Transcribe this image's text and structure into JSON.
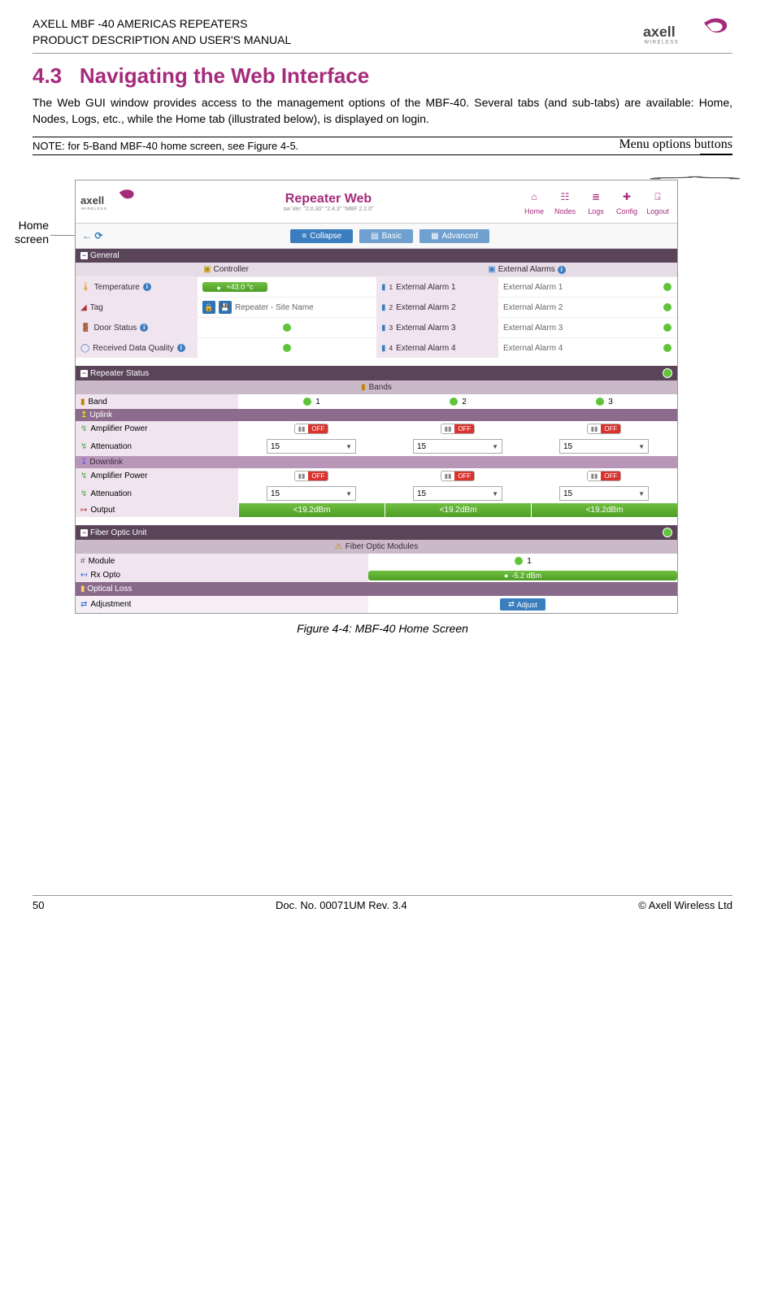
{
  "header": {
    "line1": "AXELL MBF -40 AMERICAS REPEATERS",
    "line2": "PRODUCT DESCRIPTION AND USER'S MANUAL",
    "logo_text": "axell",
    "logo_sub": "WIRELESS"
  },
  "section": {
    "number": "4.3",
    "title": "Navigating the Web Interface"
  },
  "para": "The Web GUI window provides access to the management options of the MBF-40. Several tabs (and sub-tabs) are available: Home, Nodes, Logs, etc., while the Home tab (illustrated below), is displayed on login.",
  "note": "NOTE: for 5-Band MBF-40 home screen, see Figure  4-5.",
  "annot": {
    "menu": "Menu options buttons",
    "home1": "Home",
    "home2": "screen"
  },
  "ss": {
    "logo": "axell",
    "logo_sub": "WIRELESS",
    "title": "Repeater Web",
    "swver": "sw Ver: \"2.0.30\" \"2.4.3\" \"MBF 2.2.0\"",
    "nav": [
      "Home",
      "Nodes",
      "Logs",
      "Config",
      "Logout"
    ],
    "btns": {
      "collapse": "Collapse",
      "basic": "Basic",
      "advanced": "Advanced"
    },
    "general": {
      "hdr": "General",
      "controller": "Controller",
      "ext_alarms": "External Alarms",
      "rows_left": [
        {
          "label": "Temperature",
          "info": true,
          "value_pill": "+43.0 °c"
        },
        {
          "label": "Tag",
          "value_text": "Repeater - Site Name",
          "boxes": true
        },
        {
          "label": "Door Status",
          "info": true,
          "dot": true
        },
        {
          "label": "Received Data Quality",
          "info": true,
          "dot": true
        }
      ],
      "rows_right": [
        {
          "num": "1",
          "label": "External Alarm 1",
          "value": "External Alarm 1"
        },
        {
          "num": "2",
          "label": "External Alarm 2",
          "value": "External Alarm 2"
        },
        {
          "num": "3",
          "label": "External Alarm 3",
          "value": "External Alarm 3"
        },
        {
          "num": "4",
          "label": "External Alarm 4",
          "value": "External Alarm 4"
        }
      ]
    },
    "repeater": {
      "hdr": "Repeater Status",
      "bands_hdr": "Bands",
      "band_lbl": "Band",
      "bands": [
        "1",
        "2",
        "3"
      ],
      "uplink": "Uplink",
      "downlink": "Downlink",
      "amp": "Amplifier Power",
      "att": "Attenuation",
      "att_val": "15",
      "output_lbl": "Output",
      "output_val": "<19.2dBm",
      "off": "OFF"
    },
    "fiber": {
      "hdr": "Fiber Optic Unit",
      "modules_hdr": "Fiber Optic Modules",
      "module_lbl": "Module",
      "module_num": "1",
      "rx_lbl": "Rx Opto",
      "rx_val": "-5.2 dBm",
      "ol_lbl": "Optical Loss",
      "adj_lbl": "Adjustment",
      "adj_btn": "Adjust"
    }
  },
  "caption": "Figure  4-4:  MBF-40 Home Screen",
  "footer": {
    "left": "50",
    "center": "Doc. No. 00071UM Rev. 3.4",
    "right": "© Axell Wireless Ltd"
  }
}
